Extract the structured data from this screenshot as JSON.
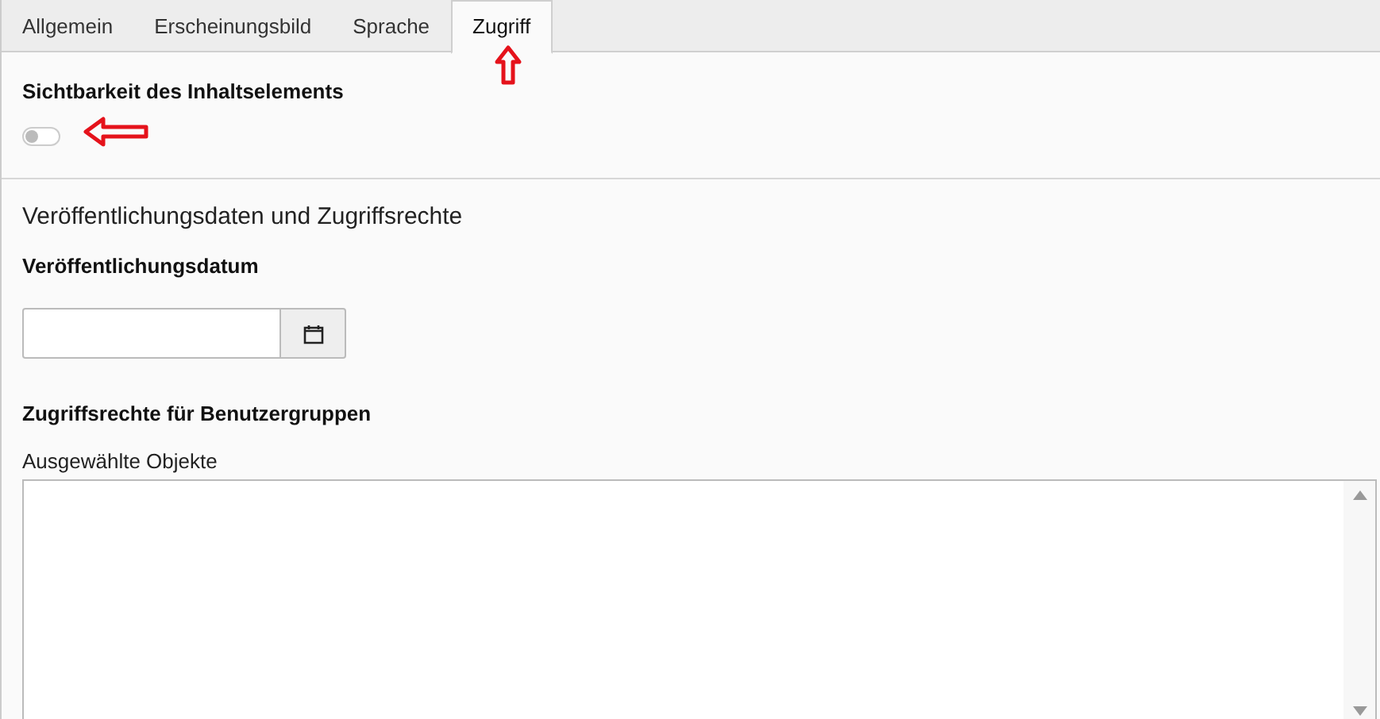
{
  "tabs": [
    {
      "label": "Allgemein",
      "selected": false
    },
    {
      "label": "Erscheinungsbild",
      "selected": false
    },
    {
      "label": "Sprache",
      "selected": false
    },
    {
      "label": "Zugriff",
      "selected": true
    }
  ],
  "visibility": {
    "label": "Sichtbarkeit des Inhaltselements",
    "on": false
  },
  "section_title": "Veröffentlichungsdaten und Zugriffsrechte",
  "publish_date": {
    "label": "Veröffentlichungsdatum"
  },
  "access": {
    "label": "Zugriffsrechte für Benutzergruppen",
    "sublabel": "Ausgewählte Objekte"
  }
}
